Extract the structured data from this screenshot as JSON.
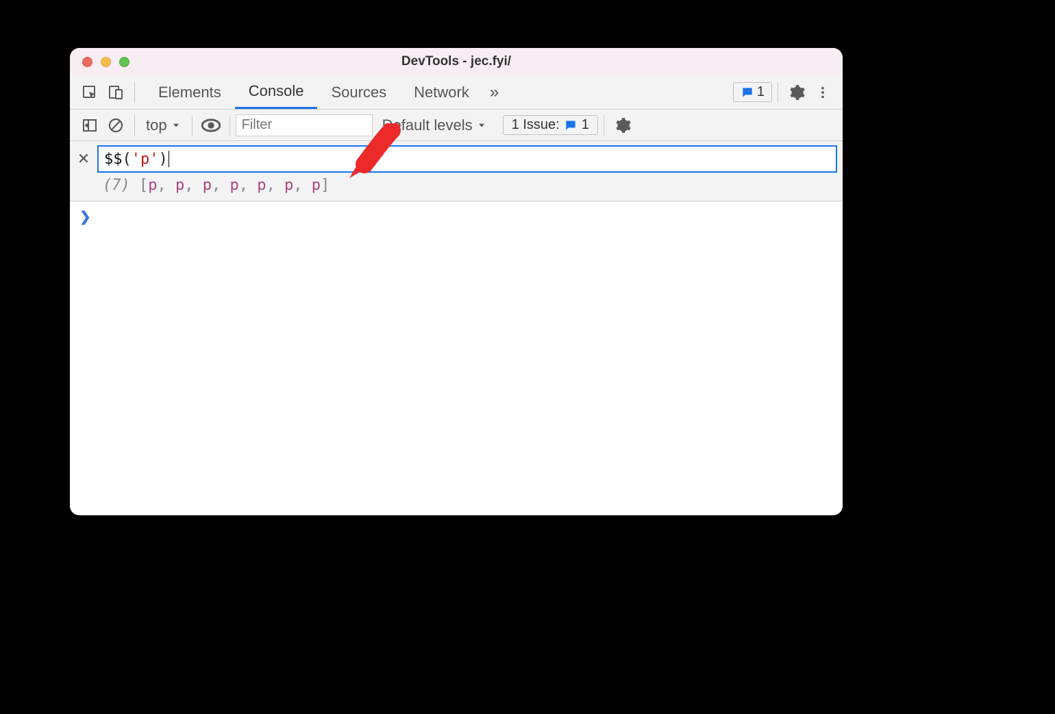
{
  "window": {
    "title": "DevTools - jec.fyi/"
  },
  "tabs": {
    "items": [
      "Elements",
      "Console",
      "Sources",
      "Network"
    ],
    "active": "Console",
    "overflow_icon": "»",
    "feedback_count": "1"
  },
  "console_toolbar": {
    "context": "top",
    "filter_placeholder": "Filter",
    "levels_label": "Default levels",
    "issues_label": "1 Issue:",
    "issues_count": "1"
  },
  "console": {
    "input_code": {
      "dollar": "$$",
      "open": "(",
      "string": "'p'",
      "close": ")"
    },
    "preview": {
      "count": "(7)",
      "open": "[",
      "items": [
        "p",
        "p",
        "p",
        "p",
        "p",
        "p",
        "p"
      ],
      "close": "]"
    }
  }
}
